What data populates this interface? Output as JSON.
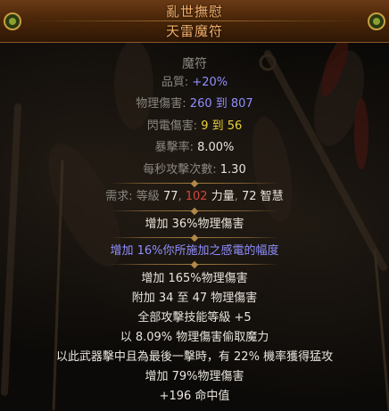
{
  "item": {
    "name": "亂世撫慰",
    "base_type": "天雷魔符",
    "item_class": "魔符"
  },
  "properties": [
    {
      "label": "品質: ",
      "value": "+20%",
      "value_color": "blue"
    },
    {
      "label": "物理傷害: ",
      "value": "260 到 807",
      "value_color": "blue"
    },
    {
      "label": "閃電傷害: ",
      "value": "9 到 56",
      "value_color": "yellow"
    },
    {
      "label": "暴擊率: ",
      "value": "8.00%",
      "value_color": "white"
    },
    {
      "label": "每秒攻擊次數: ",
      "value": "1.30",
      "value_color": "white"
    }
  ],
  "requirements": {
    "label": "需求: 等級 ",
    "level": "77",
    "sep1": ", ",
    "str_value": "102",
    "str_label": " 力量",
    "sep2": ", ",
    "int_value": "72",
    "int_label": " 智慧"
  },
  "implicit_mod": "增加 36%物理傷害",
  "enchant_mod": "增加 16%你所施加之感電的幅度",
  "explicit_mods": [
    "增加 165%物理傷害",
    "附加 34 至 47 物理傷害",
    "全部攻擊技能等級 +5",
    "以 8.09% 物理傷害偷取魔力",
    "以此武器擊中且為最後一擊時，有 22% 機率獲得猛攻",
    "增加 79%物理傷害",
    "+196 命中值"
  ],
  "colors": {
    "header_text": "#f5b06a",
    "magic_blue": "#8f8fff",
    "lightning_yellow": "#e8d23a",
    "unmet_red": "#d0453a",
    "label_grey": "#8a8780"
  }
}
